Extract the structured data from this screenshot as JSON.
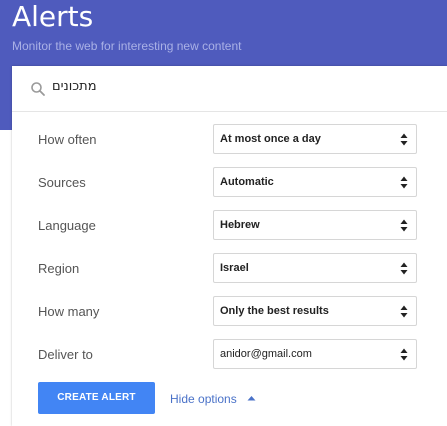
{
  "header": {
    "title": "Alerts",
    "subtitle": "Monitor the web for interesting new content"
  },
  "search": {
    "query": "מתכונים",
    "icon": "search-icon"
  },
  "options": [
    {
      "key": "how_often",
      "label": "How often",
      "value": "At most once a day"
    },
    {
      "key": "sources",
      "label": "Sources",
      "value": "Automatic"
    },
    {
      "key": "language",
      "label": "Language",
      "value": "Hebrew"
    },
    {
      "key": "region",
      "label": "Region",
      "value": "Israel"
    },
    {
      "key": "how_many",
      "label": "How many",
      "value": "Only the best results"
    },
    {
      "key": "deliver_to",
      "label": "Deliver to",
      "value": "anidor@gmail.com"
    }
  ],
  "actions": {
    "create_label": "CREATE ALERT",
    "hide_options_label": "Hide options"
  },
  "colors": {
    "header_bg": "#4f5bbd",
    "button_bg": "#4285f4",
    "link": "#4a72c8"
  }
}
